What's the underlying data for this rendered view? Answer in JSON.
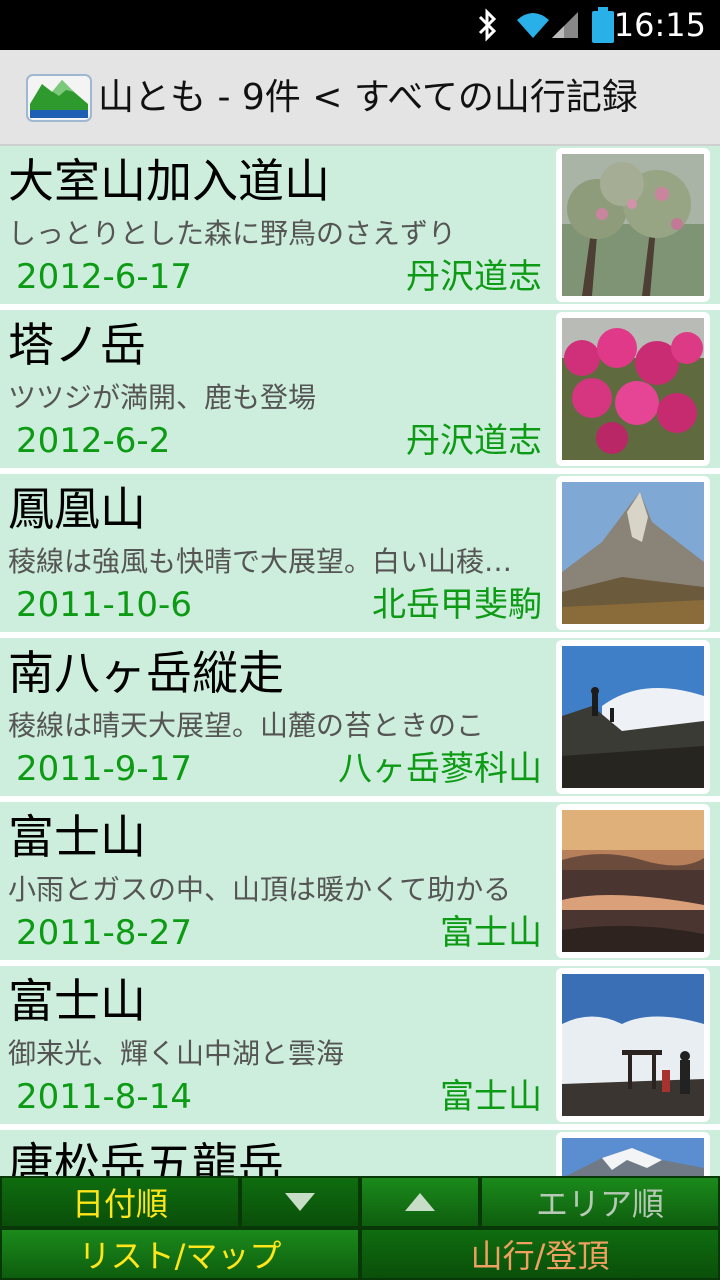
{
  "status_bar": {
    "time": "16:15",
    "icons": [
      "bluetooth-icon",
      "wifi-icon",
      "signal-icon",
      "battery-icon"
    ]
  },
  "title_bar": {
    "app_icon": "mountain-icon",
    "title": "山とも - 9件 < すべての山行記録"
  },
  "records": [
    {
      "name": "大室山加入道山",
      "desc": "しっとりとした森に野鳥のさえずり",
      "date": "2012-6-17",
      "area": "丹沢道志"
    },
    {
      "name": "塔ノ岳",
      "desc": "ツツジが満開、鹿も登場",
      "date": "2012-6-2",
      "area": "丹沢道志"
    },
    {
      "name": "鳳凰山",
      "desc": "稜線は強風も快晴で大展望。白い山稜…",
      "date": "2011-10-6",
      "area": "北岳甲斐駒"
    },
    {
      "name": "南八ヶ岳縦走",
      "desc": "稜線は晴天大展望。山麓の苔ときのこ",
      "date": "2011-9-17",
      "area": "八ヶ岳蓼科山"
    },
    {
      "name": "富士山",
      "desc": "小雨とガスの中、山頂は暖かくて助かる",
      "date": "2011-8-27",
      "area": "富士山"
    },
    {
      "name": "富士山",
      "desc": "御来光、輝く山中湖と雲海",
      "date": "2011-8-14",
      "area": "富士山"
    },
    {
      "name": "唐松岳五龍岳",
      "desc": "",
      "date": "",
      "area": ""
    }
  ],
  "bottom_bar": {
    "sort_date": "日付順",
    "sort_desc_icon": "triangle-down-icon",
    "sort_asc_icon": "triangle-up-icon",
    "sort_area": "エリア順",
    "list_map": "リスト/マップ",
    "trip_summit": "山行/登頂"
  },
  "colors": {
    "row_background": "#cdeedc",
    "accent_green": "#0d9a14",
    "button_text": "#ffe61a"
  }
}
